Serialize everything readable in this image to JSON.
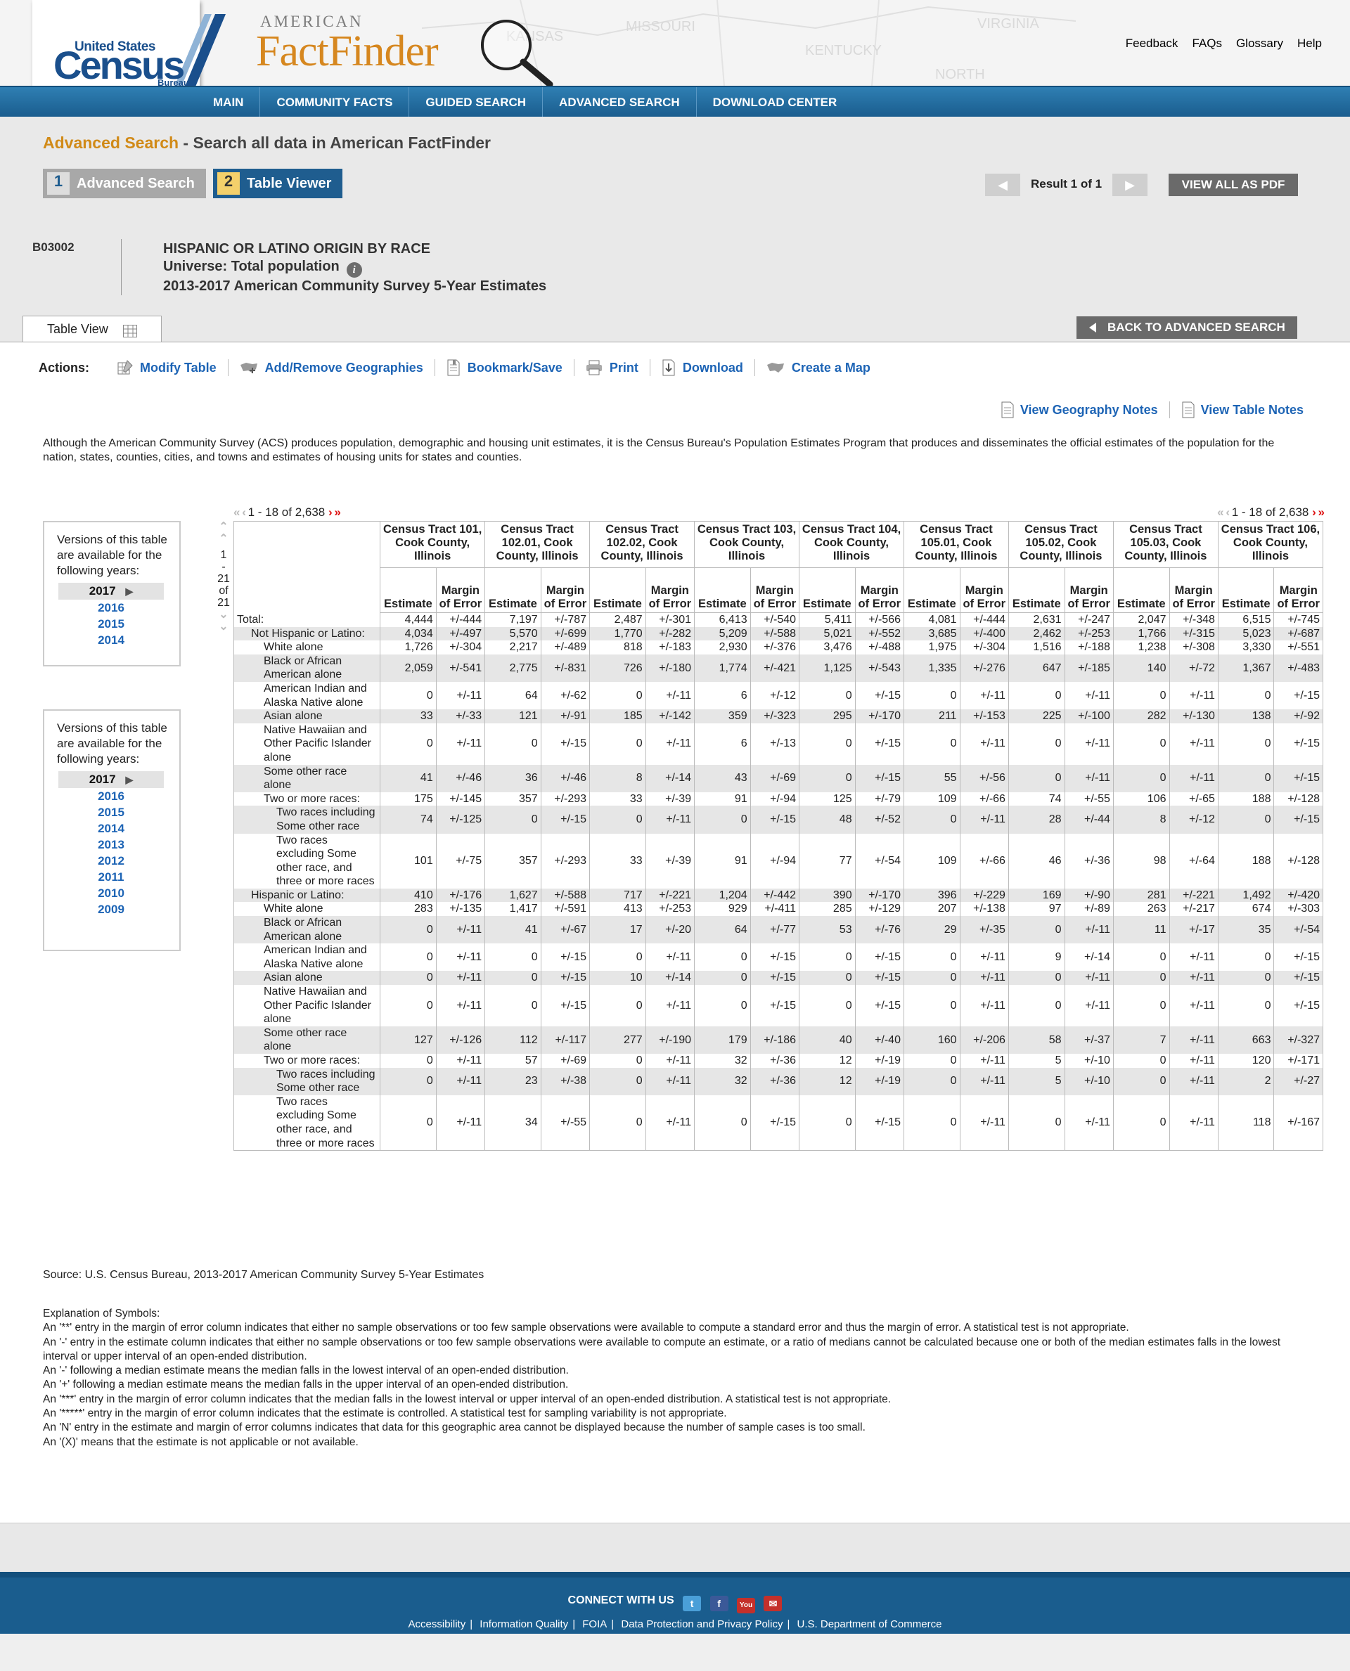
{
  "header": {
    "logo_us": "United States",
    "logo_census": "Census",
    "logo_bureau": "Bureau",
    "af_american": "AMERICAN",
    "af_factfinder": "FactFinder",
    "top_links": [
      "Feedback",
      "FAQs",
      "Glossary",
      "Help"
    ],
    "map_labels": [
      "MISSOURI",
      "KENTUCKY",
      "VIRGINIA",
      "NORTH",
      "KANSAS"
    ]
  },
  "nav": [
    "MAIN",
    "COMMUNITY FACTS",
    "GUIDED SEARCH",
    "ADVANCED SEARCH",
    "DOWNLOAD CENTER"
  ],
  "page": {
    "heading_highlight": "Advanced Search",
    "heading_rest": " - Search all data in American FactFinder",
    "step1_num": "1",
    "step1_label": "Advanced Search",
    "step2_num": "2",
    "step2_label": "Table Viewer",
    "result_text": "Result 1 of 1",
    "view_pdf": "VIEW ALL AS PDF",
    "table_id": "B03002",
    "table_title": "HISPANIC OR LATINO ORIGIN BY RACE",
    "universe": "Universe: Total population",
    "survey": "2013-2017 American Community Survey 5-Year Estimates",
    "tab_label": "Table View",
    "back_button": "BACK TO ADVANCED SEARCH"
  },
  "actions": {
    "label": "Actions:",
    "items": [
      "Modify Table",
      "Add/Remove Geographies",
      "Bookmark/Save",
      "Print",
      "Download",
      "Create a Map"
    ]
  },
  "notes": [
    "View Geography Notes",
    "View Table Notes"
  ],
  "disclaimer": "Although the American Community Survey (ACS) produces population, demographic and housing unit estimates, it is the Census Bureau's Population Estimates Program that produces and disseminates the official estimates of the population for the nation, states, counties, cities, and towns and estimates of housing units for states and counties.",
  "versions_top": {
    "text": "Versions of this table are available for the following years:",
    "years": [
      "2017",
      "2016",
      "2015",
      "2014"
    ]
  },
  "versions_bottom": {
    "text": "Versions of this table are available for the following years:",
    "years": [
      "2017",
      "2016",
      "2015",
      "2014",
      "2013",
      "2012",
      "2011",
      "2010",
      "2009"
    ]
  },
  "pager": {
    "range": "1 - 18 of 2,638",
    "row_range": [
      "1",
      "-",
      "21",
      "of",
      "21"
    ]
  },
  "table": {
    "geographies": [
      "Census Tract 101, Cook County, Illinois",
      "Census Tract 102.01, Cook County, Illinois",
      "Census Tract 102.02, Cook County, Illinois",
      "Census Tract 103, Cook County, Illinois",
      "Census Tract 104, Cook County, Illinois",
      "Census Tract 105.01, Cook County, Illinois",
      "Census Tract 105.02, Cook County, Illinois",
      "Census Tract 105.03, Cook County, Illinois",
      "Census Tract 106, Cook County, Illinois"
    ],
    "sub_headers": [
      [
        "Estimate",
        "Margin of Error"
      ],
      [
        "Estimate",
        "Margin of Error"
      ],
      [
        "Estimate",
        "Margin of Error"
      ],
      [
        "Estimate",
        "Margin of Error"
      ],
      [
        "Estimate",
        "Margin of Error"
      ],
      [
        "Estimate",
        "Margin of Error"
      ],
      [
        "Estimate",
        "Margin of Error"
      ],
      [
        "Estimate",
        "Margin of Error"
      ],
      [
        "Estimate",
        "Margin of Error"
      ]
    ],
    "rows": [
      {
        "label": "Total:",
        "indent": 0,
        "values": [
          "4,444",
          "+/-444",
          "7,197",
          "+/-787",
          "2,487",
          "+/-301",
          "6,413",
          "+/-540",
          "5,411",
          "+/-566",
          "4,081",
          "+/-444",
          "2,631",
          "+/-247",
          "2,047",
          "+/-348",
          "6,515",
          "+/-745"
        ]
      },
      {
        "label": "Not Hispanic or Latino:",
        "indent": 1,
        "values": [
          "4,034",
          "+/-497",
          "5,570",
          "+/-699",
          "1,770",
          "+/-282",
          "5,209",
          "+/-588",
          "5,021",
          "+/-552",
          "3,685",
          "+/-400",
          "2,462",
          "+/-253",
          "1,766",
          "+/-315",
          "5,023",
          "+/-687"
        ]
      },
      {
        "label": "White alone",
        "indent": 2,
        "values": [
          "1,726",
          "+/-304",
          "2,217",
          "+/-489",
          "818",
          "+/-183",
          "2,930",
          "+/-376",
          "3,476",
          "+/-488",
          "1,975",
          "+/-304",
          "1,516",
          "+/-188",
          "1,238",
          "+/-308",
          "3,330",
          "+/-551"
        ]
      },
      {
        "label": "Black or African American alone",
        "indent": 2,
        "values": [
          "2,059",
          "+/-541",
          "2,775",
          "+/-831",
          "726",
          "+/-180",
          "1,774",
          "+/-421",
          "1,125",
          "+/-543",
          "1,335",
          "+/-276",
          "647",
          "+/-185",
          "140",
          "+/-72",
          "1,367",
          "+/-483"
        ]
      },
      {
        "label": "American Indian and Alaska Native alone",
        "indent": 2,
        "values": [
          "0",
          "+/-11",
          "64",
          "+/-62",
          "0",
          "+/-11",
          "6",
          "+/-12",
          "0",
          "+/-15",
          "0",
          "+/-11",
          "0",
          "+/-11",
          "0",
          "+/-11",
          "0",
          "+/-15"
        ]
      },
      {
        "label": "Asian alone",
        "indent": 2,
        "values": [
          "33",
          "+/-33",
          "121",
          "+/-91",
          "185",
          "+/-142",
          "359",
          "+/-323",
          "295",
          "+/-170",
          "211",
          "+/-153",
          "225",
          "+/-100",
          "282",
          "+/-130",
          "138",
          "+/-92"
        ]
      },
      {
        "label": "Native Hawaiian and Other Pacific Islander alone",
        "indent": 2,
        "values": [
          "0",
          "+/-11",
          "0",
          "+/-15",
          "0",
          "+/-11",
          "6",
          "+/-13",
          "0",
          "+/-15",
          "0",
          "+/-11",
          "0",
          "+/-11",
          "0",
          "+/-11",
          "0",
          "+/-15"
        ]
      },
      {
        "label": "Some other race alone",
        "indent": 2,
        "values": [
          "41",
          "+/-46",
          "36",
          "+/-46",
          "8",
          "+/-14",
          "43",
          "+/-69",
          "0",
          "+/-15",
          "55",
          "+/-56",
          "0",
          "+/-11",
          "0",
          "+/-11",
          "0",
          "+/-15"
        ]
      },
      {
        "label": "Two or more races:",
        "indent": 2,
        "values": [
          "175",
          "+/-145",
          "357",
          "+/-293",
          "33",
          "+/-39",
          "91",
          "+/-94",
          "125",
          "+/-79",
          "109",
          "+/-66",
          "74",
          "+/-55",
          "106",
          "+/-65",
          "188",
          "+/-128"
        ]
      },
      {
        "label": "Two races including Some other race",
        "indent": 3,
        "values": [
          "74",
          "+/-125",
          "0",
          "+/-15",
          "0",
          "+/-11",
          "0",
          "+/-15",
          "48",
          "+/-52",
          "0",
          "+/-11",
          "28",
          "+/-44",
          "8",
          "+/-12",
          "0",
          "+/-15"
        ]
      },
      {
        "label": "Two races excluding Some other race, and three or more races",
        "indent": 3,
        "values": [
          "101",
          "+/-75",
          "357",
          "+/-293",
          "33",
          "+/-39",
          "91",
          "+/-94",
          "77",
          "+/-54",
          "109",
          "+/-66",
          "46",
          "+/-36",
          "98",
          "+/-64",
          "188",
          "+/-128"
        ]
      },
      {
        "label": "Hispanic or Latino:",
        "indent": 1,
        "values": [
          "410",
          "+/-176",
          "1,627",
          "+/-588",
          "717",
          "+/-221",
          "1,204",
          "+/-442",
          "390",
          "+/-170",
          "396",
          "+/-229",
          "169",
          "+/-90",
          "281",
          "+/-221",
          "1,492",
          "+/-420"
        ]
      },
      {
        "label": "White alone",
        "indent": 2,
        "values": [
          "283",
          "+/-135",
          "1,417",
          "+/-591",
          "413",
          "+/-253",
          "929",
          "+/-411",
          "285",
          "+/-129",
          "207",
          "+/-138",
          "97",
          "+/-89",
          "263",
          "+/-217",
          "674",
          "+/-303"
        ]
      },
      {
        "label": "Black or African American alone",
        "indent": 2,
        "values": [
          "0",
          "+/-11",
          "41",
          "+/-67",
          "17",
          "+/-20",
          "64",
          "+/-77",
          "53",
          "+/-76",
          "29",
          "+/-35",
          "0",
          "+/-11",
          "11",
          "+/-17",
          "35",
          "+/-54"
        ]
      },
      {
        "label": "American Indian and Alaska Native alone",
        "indent": 2,
        "values": [
          "0",
          "+/-11",
          "0",
          "+/-15",
          "0",
          "+/-11",
          "0",
          "+/-15",
          "0",
          "+/-15",
          "0",
          "+/-11",
          "9",
          "+/-14",
          "0",
          "+/-11",
          "0",
          "+/-15"
        ]
      },
      {
        "label": "Asian alone",
        "indent": 2,
        "values": [
          "0",
          "+/-11",
          "0",
          "+/-15",
          "10",
          "+/-14",
          "0",
          "+/-15",
          "0",
          "+/-15",
          "0",
          "+/-11",
          "0",
          "+/-11",
          "0",
          "+/-11",
          "0",
          "+/-15"
        ]
      },
      {
        "label": "Native Hawaiian and Other Pacific Islander alone",
        "indent": 2,
        "values": [
          "0",
          "+/-11",
          "0",
          "+/-15",
          "0",
          "+/-11",
          "0",
          "+/-15",
          "0",
          "+/-15",
          "0",
          "+/-11",
          "0",
          "+/-11",
          "0",
          "+/-11",
          "0",
          "+/-15"
        ]
      },
      {
        "label": "Some other race alone",
        "indent": 2,
        "values": [
          "127",
          "+/-126",
          "112",
          "+/-117",
          "277",
          "+/-190",
          "179",
          "+/-186",
          "40",
          "+/-40",
          "160",
          "+/-206",
          "58",
          "+/-37",
          "7",
          "+/-11",
          "663",
          "+/-327"
        ]
      },
      {
        "label": "Two or more races:",
        "indent": 2,
        "values": [
          "0",
          "+/-11",
          "57",
          "+/-69",
          "0",
          "+/-11",
          "32",
          "+/-36",
          "12",
          "+/-19",
          "0",
          "+/-11",
          "5",
          "+/-10",
          "0",
          "+/-11",
          "120",
          "+/-171"
        ]
      },
      {
        "label": "Two races including Some other race",
        "indent": 3,
        "values": [
          "0",
          "+/-11",
          "23",
          "+/-38",
          "0",
          "+/-11",
          "32",
          "+/-36",
          "12",
          "+/-19",
          "0",
          "+/-11",
          "5",
          "+/-10",
          "0",
          "+/-11",
          "2",
          "+/-27"
        ]
      },
      {
        "label": "Two races excluding Some other race, and three or more races",
        "indent": 3,
        "values": [
          "0",
          "+/-11",
          "34",
          "+/-55",
          "0",
          "+/-11",
          "0",
          "+/-15",
          "0",
          "+/-15",
          "0",
          "+/-11",
          "0",
          "+/-11",
          "0",
          "+/-11",
          "118",
          "+/-167"
        ]
      }
    ]
  },
  "source": "Source: U.S. Census Bureau, 2013-2017 American Community Survey 5-Year Estimates",
  "explanation": [
    "Explanation of Symbols:",
    "An '**' entry in the margin of error column indicates that either no sample observations or too few sample observations were available to compute a standard error and thus the margin of error. A statistical test is not appropriate.",
    "An '-' entry in the estimate column indicates that either no sample observations or too few sample observations were available to compute an estimate, or a ratio of medians cannot be calculated because one or both of the median estimates falls in the lowest interval or upper interval of an open-ended distribution.",
    "An '-' following a median estimate means the median falls in the lowest interval of an open-ended distribution.",
    "An '+' following a median estimate means the median falls in the upper interval of an open-ended distribution.",
    "An '***' entry in the margin of error column indicates that the median falls in the lowest interval or upper interval of an open-ended distribution. A statistical test is not appropriate.",
    "An '*****' entry in the margin of error column indicates that the estimate is controlled. A statistical test for sampling variability is not appropriate.",
    "An 'N' entry in the estimate and margin of error columns indicates that data for this geographic area cannot be displayed because the number of sample cases is too small.",
    "An '(X)' means that the estimate is not applicable or not available."
  ],
  "footer": {
    "connect": "CONNECT WITH US",
    "social_icons": [
      "twitter-icon",
      "facebook-icon",
      "youtube-icon",
      "email-icon"
    ],
    "links": [
      "Accessibility",
      "Information Quality",
      "FOIA",
      "Data Protection and Privacy Policy",
      "U.S. Department of Commerce"
    ]
  },
  "colors": {
    "nav_blue": "#1a5d8e",
    "link_blue": "#1d64b5",
    "accent_orange": "#d18a17",
    "shade_row": "#e6e6e6"
  }
}
